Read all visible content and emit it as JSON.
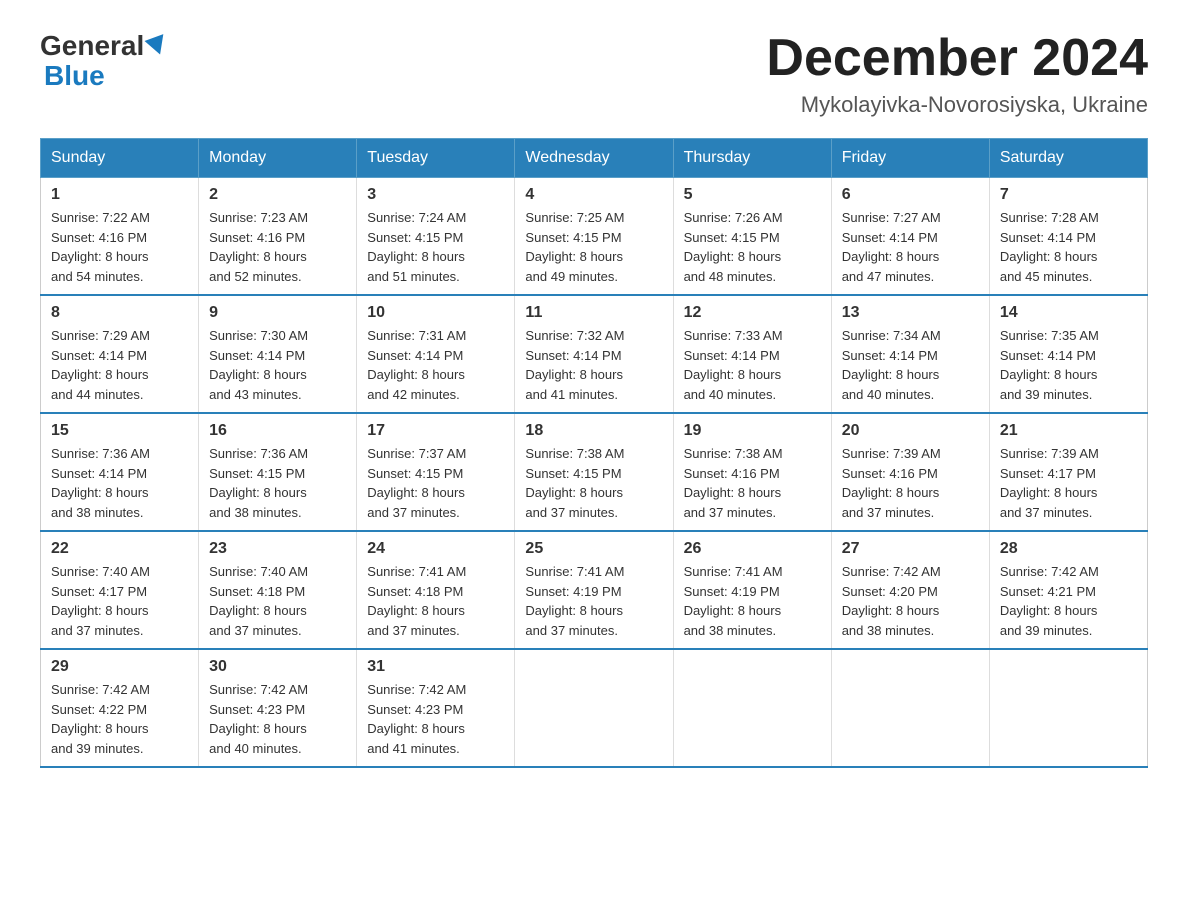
{
  "header": {
    "logo_general": "General",
    "logo_blue": "Blue",
    "month_title": "December 2024",
    "location": "Mykolayivka-Novorosiyska, Ukraine"
  },
  "weekdays": [
    "Sunday",
    "Monday",
    "Tuesday",
    "Wednesday",
    "Thursday",
    "Friday",
    "Saturday"
  ],
  "weeks": [
    [
      {
        "day": "1",
        "sunrise": "7:22 AM",
        "sunset": "4:16 PM",
        "daylight": "8 hours and 54 minutes."
      },
      {
        "day": "2",
        "sunrise": "7:23 AM",
        "sunset": "4:16 PM",
        "daylight": "8 hours and 52 minutes."
      },
      {
        "day": "3",
        "sunrise": "7:24 AM",
        "sunset": "4:15 PM",
        "daylight": "8 hours and 51 minutes."
      },
      {
        "day": "4",
        "sunrise": "7:25 AM",
        "sunset": "4:15 PM",
        "daylight": "8 hours and 49 minutes."
      },
      {
        "day": "5",
        "sunrise": "7:26 AM",
        "sunset": "4:15 PM",
        "daylight": "8 hours and 48 minutes."
      },
      {
        "day": "6",
        "sunrise": "7:27 AM",
        "sunset": "4:14 PM",
        "daylight": "8 hours and 47 minutes."
      },
      {
        "day": "7",
        "sunrise": "7:28 AM",
        "sunset": "4:14 PM",
        "daylight": "8 hours and 45 minutes."
      }
    ],
    [
      {
        "day": "8",
        "sunrise": "7:29 AM",
        "sunset": "4:14 PM",
        "daylight": "8 hours and 44 minutes."
      },
      {
        "day": "9",
        "sunrise": "7:30 AM",
        "sunset": "4:14 PM",
        "daylight": "8 hours and 43 minutes."
      },
      {
        "day": "10",
        "sunrise": "7:31 AM",
        "sunset": "4:14 PM",
        "daylight": "8 hours and 42 minutes."
      },
      {
        "day": "11",
        "sunrise": "7:32 AM",
        "sunset": "4:14 PM",
        "daylight": "8 hours and 41 minutes."
      },
      {
        "day": "12",
        "sunrise": "7:33 AM",
        "sunset": "4:14 PM",
        "daylight": "8 hours and 40 minutes."
      },
      {
        "day": "13",
        "sunrise": "7:34 AM",
        "sunset": "4:14 PM",
        "daylight": "8 hours and 40 minutes."
      },
      {
        "day": "14",
        "sunrise": "7:35 AM",
        "sunset": "4:14 PM",
        "daylight": "8 hours and 39 minutes."
      }
    ],
    [
      {
        "day": "15",
        "sunrise": "7:36 AM",
        "sunset": "4:14 PM",
        "daylight": "8 hours and 38 minutes."
      },
      {
        "day": "16",
        "sunrise": "7:36 AM",
        "sunset": "4:15 PM",
        "daylight": "8 hours and 38 minutes."
      },
      {
        "day": "17",
        "sunrise": "7:37 AM",
        "sunset": "4:15 PM",
        "daylight": "8 hours and 37 minutes."
      },
      {
        "day": "18",
        "sunrise": "7:38 AM",
        "sunset": "4:15 PM",
        "daylight": "8 hours and 37 minutes."
      },
      {
        "day": "19",
        "sunrise": "7:38 AM",
        "sunset": "4:16 PM",
        "daylight": "8 hours and 37 minutes."
      },
      {
        "day": "20",
        "sunrise": "7:39 AM",
        "sunset": "4:16 PM",
        "daylight": "8 hours and 37 minutes."
      },
      {
        "day": "21",
        "sunrise": "7:39 AM",
        "sunset": "4:17 PM",
        "daylight": "8 hours and 37 minutes."
      }
    ],
    [
      {
        "day": "22",
        "sunrise": "7:40 AM",
        "sunset": "4:17 PM",
        "daylight": "8 hours and 37 minutes."
      },
      {
        "day": "23",
        "sunrise": "7:40 AM",
        "sunset": "4:18 PM",
        "daylight": "8 hours and 37 minutes."
      },
      {
        "day": "24",
        "sunrise": "7:41 AM",
        "sunset": "4:18 PM",
        "daylight": "8 hours and 37 minutes."
      },
      {
        "day": "25",
        "sunrise": "7:41 AM",
        "sunset": "4:19 PM",
        "daylight": "8 hours and 37 minutes."
      },
      {
        "day": "26",
        "sunrise": "7:41 AM",
        "sunset": "4:19 PM",
        "daylight": "8 hours and 38 minutes."
      },
      {
        "day": "27",
        "sunrise": "7:42 AM",
        "sunset": "4:20 PM",
        "daylight": "8 hours and 38 minutes."
      },
      {
        "day": "28",
        "sunrise": "7:42 AM",
        "sunset": "4:21 PM",
        "daylight": "8 hours and 39 minutes."
      }
    ],
    [
      {
        "day": "29",
        "sunrise": "7:42 AM",
        "sunset": "4:22 PM",
        "daylight": "8 hours and 39 minutes."
      },
      {
        "day": "30",
        "sunrise": "7:42 AM",
        "sunset": "4:23 PM",
        "daylight": "8 hours and 40 minutes."
      },
      {
        "day": "31",
        "sunrise": "7:42 AM",
        "sunset": "4:23 PM",
        "daylight": "8 hours and 41 minutes."
      },
      null,
      null,
      null,
      null
    ]
  ],
  "labels": {
    "sunrise": "Sunrise:",
    "sunset": "Sunset:",
    "daylight": "Daylight:"
  }
}
